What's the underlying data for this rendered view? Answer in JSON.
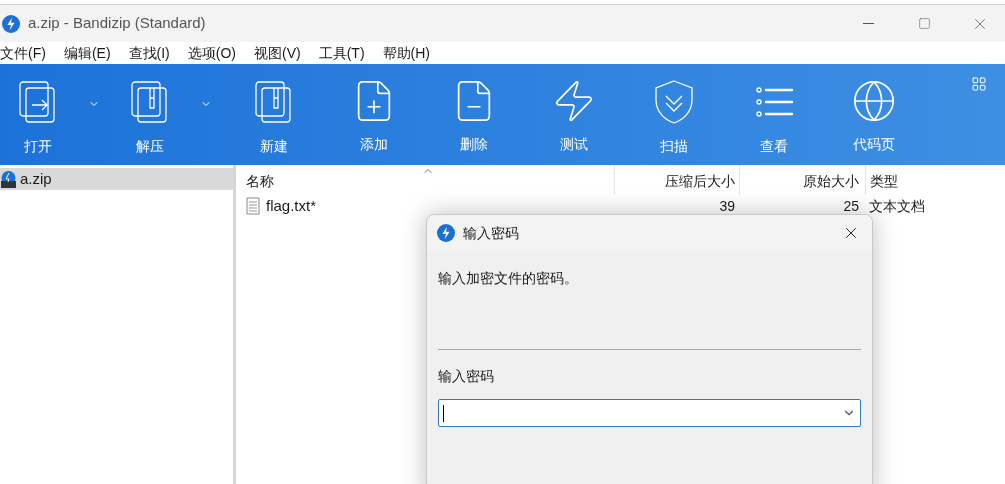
{
  "window": {
    "title": "a.zip - Bandizip (Standard)"
  },
  "menu": [
    "文件(F)",
    "编辑(E)",
    "查找(I)",
    "选项(O)",
    "视图(V)",
    "工具(T)",
    "帮助(H)"
  ],
  "toolbar": [
    {
      "label": "打开",
      "dropdown": true
    },
    {
      "label": "解压",
      "dropdown": true
    },
    {
      "label": "新建",
      "dropdown": false
    },
    {
      "label": "添加",
      "dropdown": false
    },
    {
      "label": "删除",
      "dropdown": false
    },
    {
      "label": "测试",
      "dropdown": false
    },
    {
      "label": "扫描",
      "dropdown": false
    },
    {
      "label": "查看",
      "dropdown": false
    },
    {
      "label": "代码页",
      "dropdown": false
    }
  ],
  "tree": [
    {
      "label": "a.zip",
      "selected": true
    }
  ],
  "table": {
    "columns": [
      "名称",
      "压缩后大小",
      "原始大小",
      "类型"
    ],
    "rows": [
      {
        "name": "flag.txt*",
        "compressed": "39",
        "original": "25",
        "type": "文本文档"
      }
    ]
  },
  "dialog": {
    "title": "输入密码",
    "message": "输入加密文件的密码。",
    "field_label": "输入密码"
  }
}
